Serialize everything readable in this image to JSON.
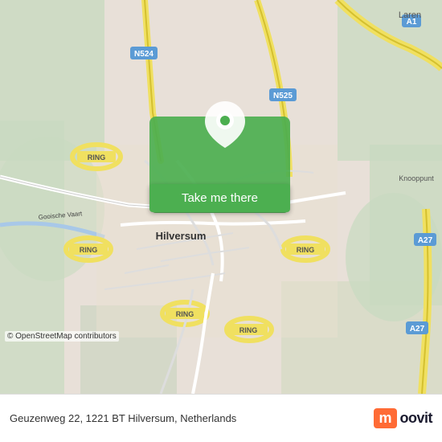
{
  "map": {
    "alt": "Map of Hilversum, Netherlands"
  },
  "button": {
    "label": "Take me there"
  },
  "info_bar": {
    "address": "Geuzenweg 22, 1221 BT Hilversum, Netherlands",
    "copyright": "© OpenStreetMap contributors"
  },
  "logo": {
    "m_letter": "m",
    "brand_name": "oovit"
  },
  "colors": {
    "green": "#4caf50",
    "road_yellow": "#f5e84e",
    "road_light": "#f0e8d0",
    "bg_green": "#c8dac0",
    "bg_tan": "#e8e0d8",
    "text_dark": "#333333",
    "white": "#ffffff",
    "moovit_orange": "#ff6b35"
  }
}
